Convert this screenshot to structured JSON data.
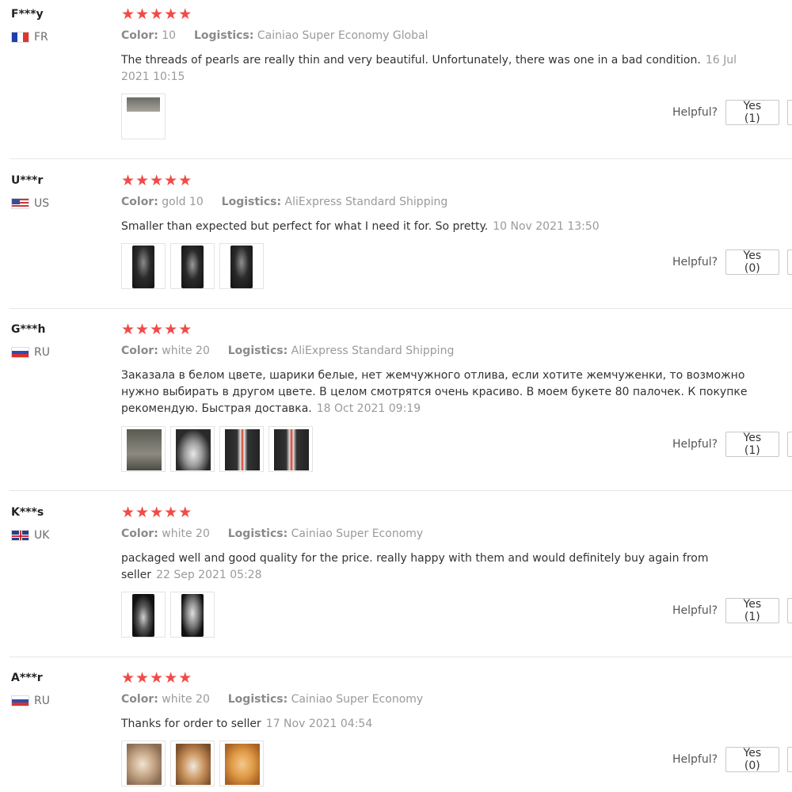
{
  "accent_star_color": "#f14b47",
  "labels": {
    "color": "Color:",
    "logistics": "Logistics:",
    "helpful": "Helpful?"
  },
  "reviews": [
    {
      "user": "F***y",
      "country": "FR",
      "flag_icon": "flag-france-icon",
      "stars": 5,
      "color": "10",
      "logistics": "Cainiao Super Economy Global",
      "text": "The threads of pearls are really thin and very beautiful. Unfortunately, there was one in a bad condition.",
      "date": "16 Jul 2021 10:15",
      "photos": [
        "photo-1"
      ],
      "yes_label": "Yes (1)"
    },
    {
      "user": "U***r",
      "country": "US",
      "flag_icon": "flag-usa-icon",
      "stars": 5,
      "color": "gold 10",
      "logistics": "AliExpress Standard Shipping",
      "text": "Smaller than expected but perfect for what I need it for. So pretty.",
      "date": "10 Nov 2021 13:50",
      "photos": [
        "photo-1",
        "photo-2",
        "photo-3"
      ],
      "yes_label": "Yes (0)"
    },
    {
      "user": "G***h",
      "country": "RU",
      "flag_icon": "flag-russia-icon",
      "stars": 5,
      "color": "white 20",
      "logistics": "AliExpress Standard Shipping",
      "text": "Заказала в белом цвете, шарики белые, нет жемчужного отлива, если хотите жемчуженки, то возможно нужно выбирать в другом цвете. В целом смотрятся очень красиво. В моем букете 80 палочек. К покупке рекомендую. Быстрая доставка.",
      "date": "18 Oct 2021 09:19",
      "photos": [
        "photo-1",
        "photo-2",
        "photo-3",
        "photo-4"
      ],
      "yes_label": "Yes (1)"
    },
    {
      "user": "K***s",
      "country": "UK",
      "flag_icon": "flag-uk-icon",
      "stars": 5,
      "color": "white 20",
      "logistics": "Cainiao Super Economy",
      "text": "packaged well and good quality for the price. really happy with them and would definitely buy again from seller",
      "date": "22 Sep 2021 05:28",
      "photos": [
        "photo-1",
        "photo-2"
      ],
      "yes_label": "Yes (1)"
    },
    {
      "user": "A***r",
      "country": "RU",
      "flag_icon": "flag-russia-icon",
      "stars": 5,
      "color": "white 20",
      "logistics": "Cainiao Super Economy",
      "text": "Thanks for order to seller",
      "date": "17 Nov 2021 04:54",
      "photos": [
        "photo-1",
        "photo-2",
        "photo-3"
      ],
      "yes_label": "Yes (0)"
    }
  ]
}
